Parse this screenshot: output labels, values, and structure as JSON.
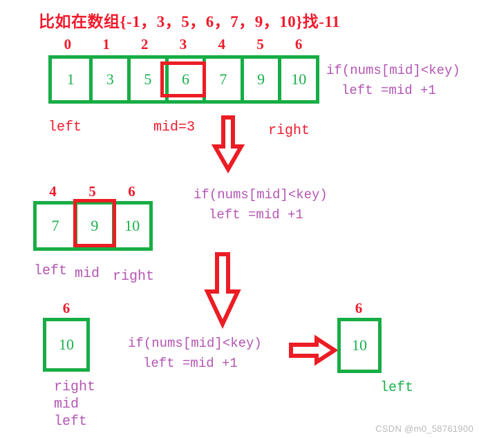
{
  "title": "比如在数组{-1，3，5，6，7，9，10}找-11",
  "colors": {
    "red": "#f11a2c",
    "green": "#17ad45",
    "purple": "#b455b4",
    "highlight": "#ec1c24",
    "watermark": "#b9b9b9"
  },
  "steps": [
    {
      "indices": [
        "0",
        "1",
        "2",
        "3",
        "4",
        "5",
        "6"
      ],
      "values": [
        "1",
        "3",
        "5",
        "6",
        "7",
        "9",
        "10"
      ],
      "highlight_index": 3,
      "pointers": [
        {
          "label": "left",
          "color": "red"
        },
        {
          "label": "mid=3",
          "color": "red"
        },
        {
          "label": "right",
          "color": "red"
        }
      ],
      "code": {
        "line1": "if(nums[mid]<key)",
        "line2": "left =mid +1"
      }
    },
    {
      "indices": [
        "4",
        "5",
        "6"
      ],
      "values": [
        "7",
        "9",
        "10"
      ],
      "highlight_index": 1,
      "pointers": [
        {
          "label": "left",
          "color": "purple"
        },
        {
          "label": "mid",
          "color": "purple"
        },
        {
          "label": "right",
          "color": "purple"
        }
      ],
      "code": {
        "line1": "if(nums[mid]<key)",
        "line2": "left =mid +1"
      }
    },
    {
      "indices": [
        "6"
      ],
      "values": [
        "10"
      ],
      "highlight_index": -1,
      "pointers": [
        {
          "label": "right",
          "color": "purple"
        },
        {
          "label": "mid",
          "color": "purple"
        },
        {
          "label": "left",
          "color": "purple"
        }
      ],
      "code": {
        "line1": "if(nums[mid]<key)",
        "line2": "left =mid +1"
      }
    }
  ],
  "result": {
    "index": "6",
    "value": "10",
    "pointer_label": "left"
  },
  "arrows": {
    "down_1": "arrow-down",
    "down_2": "arrow-down",
    "right_1": "arrow-right"
  },
  "watermark": "CSDN @m0_58761900"
}
